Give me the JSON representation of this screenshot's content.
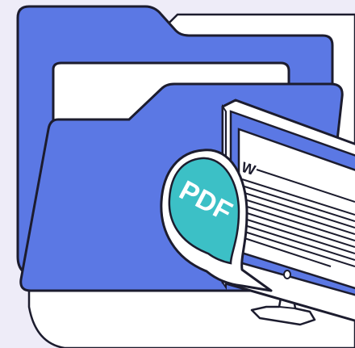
{
  "illustration": {
    "badge_text": "PDF",
    "document_initial": "W",
    "colors": {
      "background": "#eeecf8",
      "card": "#ffffff",
      "folder_blue": "#5b78e4",
      "badge_teal": "#3cc0c6",
      "outline": "#1c1c2e"
    },
    "icons": [
      "folder-icon",
      "pdf-speech-bubble-icon",
      "monitor-icon",
      "word-document-icon"
    ]
  }
}
